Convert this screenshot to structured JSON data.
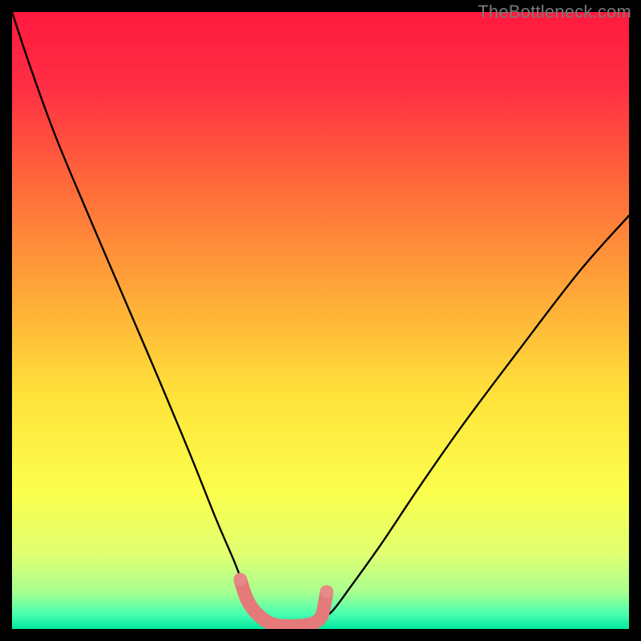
{
  "watermark": "TheBottleneck.com",
  "colors": {
    "gradient_stops": [
      {
        "offset": 0.0,
        "color": "#ff1a3e"
      },
      {
        "offset": 0.12,
        "color": "#ff2e44"
      },
      {
        "offset": 0.28,
        "color": "#ff6a3a"
      },
      {
        "offset": 0.45,
        "color": "#ffa638"
      },
      {
        "offset": 0.62,
        "color": "#ffe23a"
      },
      {
        "offset": 0.78,
        "color": "#fbff4d"
      },
      {
        "offset": 0.88,
        "color": "#dfff72"
      },
      {
        "offset": 0.94,
        "color": "#a8ff8f"
      },
      {
        "offset": 0.975,
        "color": "#4dffb0"
      },
      {
        "offset": 1.0,
        "color": "#00e8a0"
      }
    ],
    "curve": "#000000",
    "floor_marker": "#e47a7a",
    "floor_marker_end": "#e58a86"
  },
  "chart_data": {
    "type": "line",
    "title": "",
    "xlabel": "",
    "ylabel": "",
    "xlim": [
      0,
      100
    ],
    "ylim": [
      0,
      100
    ],
    "note": "X/Y are unitless percentages of the plot area; no axes or ticks are drawn in the image. The curve is a V-shaped bottleneck curve with a flat minimum segment highlighted near the bottom.",
    "series": [
      {
        "name": "bottleneck-curve",
        "x": [
          0,
          3,
          7,
          12,
          18,
          24,
          29,
          33,
          36,
          38,
          40,
          41,
          41.5,
          42,
          48,
          49,
          50,
          52,
          55,
          60,
          66,
          73,
          82,
          92,
          100
        ],
        "values": [
          100,
          91,
          80,
          68,
          54,
          40,
          28,
          18,
          11,
          6,
          3,
          1,
          0.5,
          0.3,
          0.3,
          0.7,
          1.5,
          3,
          7,
          14,
          23,
          33,
          45,
          58,
          67
        ]
      }
    ],
    "floor_marker": {
      "name": "optimal-range",
      "x": [
        37,
        38,
        39,
        40,
        41,
        42,
        43,
        44,
        46,
        48,
        49,
        50,
        50.5,
        51
      ],
      "values": [
        8,
        5,
        3.3,
        2.2,
        1.4,
        0.9,
        0.6,
        0.5,
        0.5,
        0.7,
        1.0,
        1.8,
        3.2,
        6
      ],
      "stroke_width_pct": 2.2
    }
  }
}
